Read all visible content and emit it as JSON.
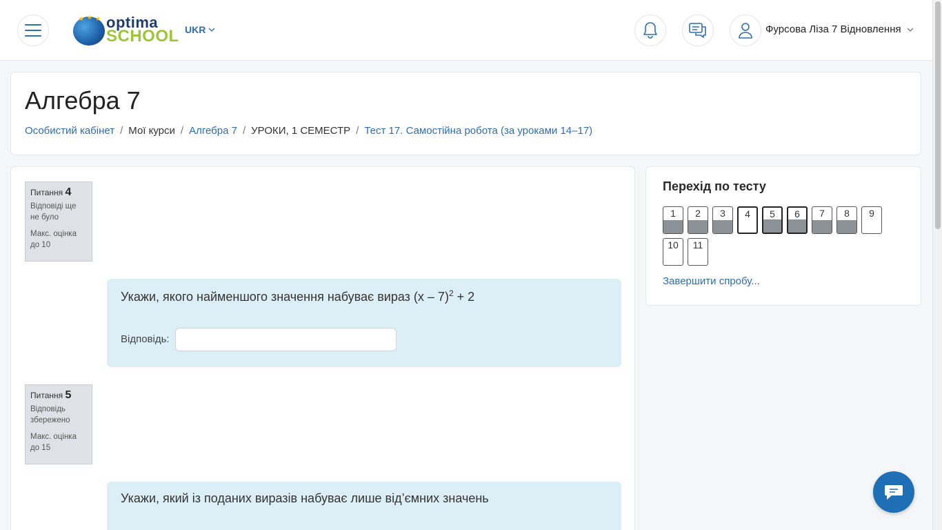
{
  "header": {
    "logo_top": "optima",
    "logo_bottom": "SCHOOL",
    "lang": "UKR",
    "username": "Фурсова Ліза 7 Відновлення"
  },
  "page": {
    "title": "Алгебра 7",
    "breadcrumb": [
      {
        "label": "Особистий кабінет"
      },
      {
        "label": "Мої курси"
      },
      {
        "label": "Алгебра 7"
      },
      {
        "label": "УРОКИ, 1 СЕМЕСТР"
      },
      {
        "label": "Тест 17. Самостійна робота (за уроками 14–17)"
      }
    ]
  },
  "questions": [
    {
      "label": "Питання",
      "number": "4",
      "status": "Відповіді ще не було",
      "max_grade": "Макс. оцінка до 10",
      "text_main": "Укажи, якого найменшого значення набуває вираз (x – 7)",
      "text_sup": "2",
      "text_tail": " + 2",
      "answer_label": "Відповідь:",
      "answer_value": ""
    },
    {
      "label": "Питання",
      "number": "5",
      "status": "Відповідь збережено",
      "max_grade": "Макс. оцінка до 15",
      "text_main": "Укажи, який із поданих виразів набуває лише від’ємних значень"
    }
  ],
  "quiz_nav": {
    "title": "Перехід по тесту",
    "buttons": [
      {
        "label": "1",
        "answered": true,
        "current": false
      },
      {
        "label": "2",
        "answered": true,
        "current": false
      },
      {
        "label": "3",
        "answered": true,
        "current": false
      },
      {
        "label": "4",
        "answered": false,
        "current": true
      },
      {
        "label": "5",
        "answered": true,
        "current": true
      },
      {
        "label": "6",
        "answered": true,
        "current": true
      },
      {
        "label": "7",
        "answered": true,
        "current": false
      },
      {
        "label": "8",
        "answered": true,
        "current": false
      },
      {
        "label": "9",
        "answered": false,
        "current": false
      },
      {
        "label": "10",
        "answered": false,
        "current": false
      },
      {
        "label": "11",
        "answered": false,
        "current": false
      }
    ],
    "finish_label": "Завершити спробу..."
  },
  "colors": {
    "accent": "#2e6db4",
    "question_bg": "#ddeff6",
    "chat_bubble": "#1e6fb5"
  }
}
